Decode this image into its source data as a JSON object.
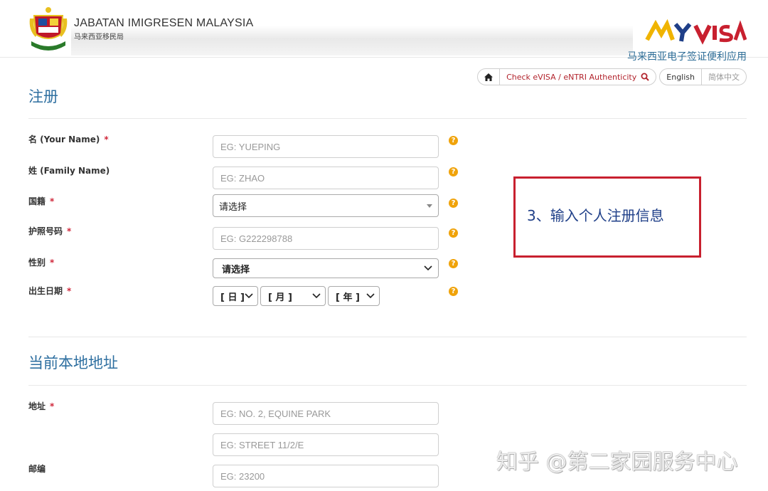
{
  "header": {
    "org_name": "JABATAN IMIGRESEN MALAYSIA",
    "org_sub": "马来西亚移民局",
    "logo_sub": "马来西亚电子签证便利应用"
  },
  "topbar": {
    "check_label": "Check eVISA / eNTRI Authenticity",
    "lang_en": "English",
    "lang_zh": "简体中文"
  },
  "register": {
    "title": "注册",
    "name_label": "名 (Your Name)",
    "name_placeholder": "EG: YUEPING",
    "family_label": "姓 (Family Name)",
    "family_placeholder": "EG: ZHAO",
    "nationality_label": "国籍",
    "nationality_value": "请选择",
    "passport_label": "护照号码",
    "passport_placeholder": "EG: G222298788",
    "gender_label": "性别",
    "gender_value": "请选择",
    "dob_label": "出生日期",
    "dob_day": "[ 日 ]",
    "dob_month": "[ 月 ]",
    "dob_year": "[ 年 ]",
    "required_mark": "*",
    "help_glyph": "?"
  },
  "address": {
    "title": "当前本地地址",
    "address_label": "地址",
    "address1_placeholder": "EG: NO. 2, EQUINE PARK",
    "address2_placeholder": "EG: STREET 11/2/E",
    "postcode_label": "邮编",
    "postcode_placeholder": "EG: 23200"
  },
  "annotation": {
    "text": "3、输入个人注册信息"
  },
  "watermark": {
    "text": "知乎 @第二家园服务中心"
  },
  "colors": {
    "accent_blue": "#2e6fa0",
    "required_red": "#d0273a",
    "help_orange": "#f0a30a",
    "annotation_red": "#c8202f"
  }
}
